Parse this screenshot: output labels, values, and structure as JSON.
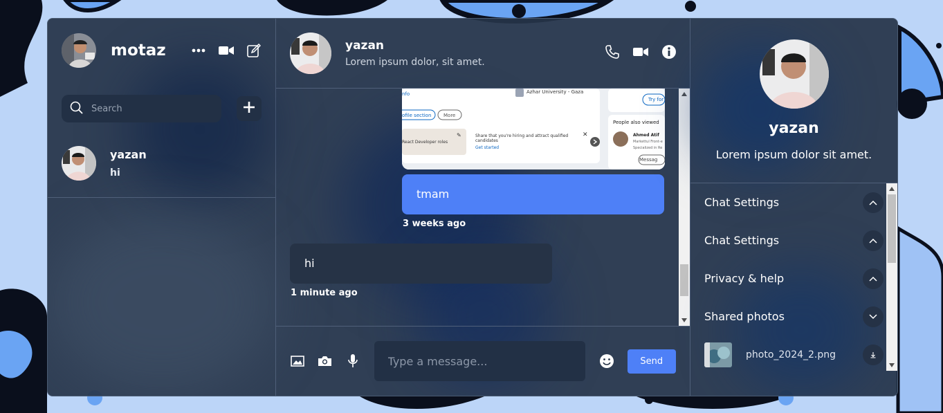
{
  "sidebar": {
    "title": "motaz",
    "search": {
      "placeholder": "Search"
    },
    "contacts": [
      {
        "name": "yazan",
        "last_message": "hi"
      }
    ]
  },
  "chat": {
    "contact_name": "yazan",
    "contact_status": "Lorem ipsum dolor, sit amet.",
    "image_message": {
      "link_1": "nfo",
      "university": "Azhar University - Gaza",
      "try_button": "Try for",
      "profile_section_button": "ofile section",
      "more_button": "More",
      "role_card_text": "React Developer roles",
      "hiring_text": "Share that you're hiring and attract qualified candidates",
      "get_started": "Get started",
      "people_title": "People also viewed",
      "person_name": "Ahmed Atif",
      "person_line_1": "Markettul Front-e",
      "person_line_2": "Specialized in Re",
      "message_button": "Messag"
    },
    "messages": [
      {
        "direction": "out",
        "text": "tmam",
        "time": "3 weeks ago"
      },
      {
        "direction": "in",
        "text": "hi",
        "time": "1 minute ago"
      }
    ],
    "composer": {
      "placeholder": "Type a message...",
      "send_label": "Send"
    }
  },
  "details": {
    "name": "yazan",
    "status": "Lorem ipsum dolor sit amet.",
    "sections": [
      {
        "label": "Chat Settings",
        "chevron": "chevron-up-icon"
      },
      {
        "label": "Chat Settings",
        "chevron": "chevron-up-icon"
      },
      {
        "label": "Privacy & help",
        "chevron": "chevron-up-icon"
      },
      {
        "label": "Shared photos",
        "chevron": "chevron-down-icon"
      }
    ],
    "photos": [
      {
        "name": "photo_2024_2.png"
      }
    ]
  },
  "colors": {
    "accent": "#4e80f7",
    "panel": "#263448",
    "input_bg": "#223045",
    "page_bg": "#b9d3f7"
  },
  "scroll": {
    "chat_position": 0.9,
    "chat_visible_fraction": 0.15,
    "settings_position": 0.0
  }
}
